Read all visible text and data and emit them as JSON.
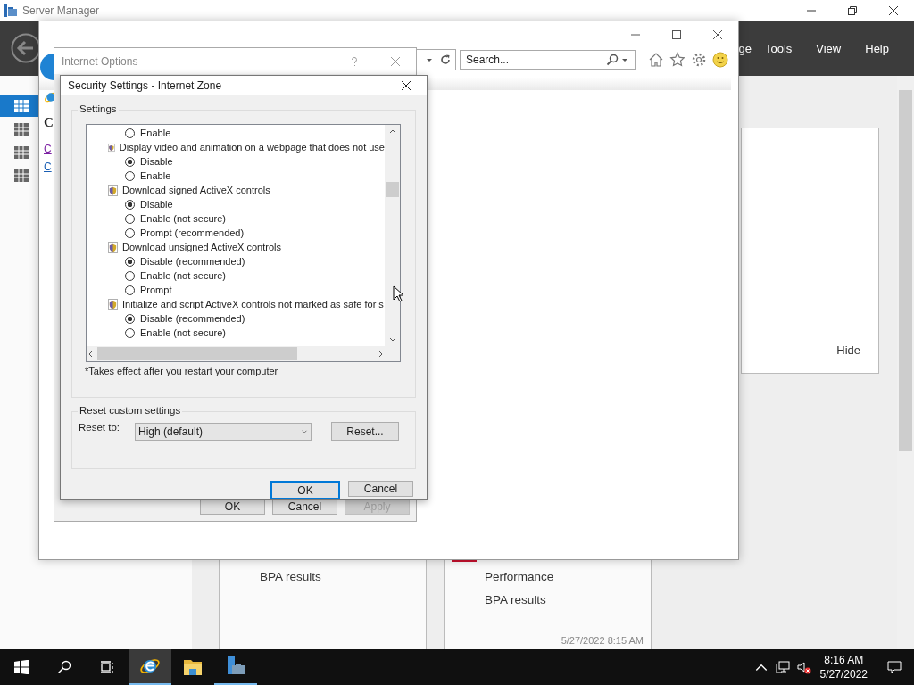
{
  "server_manager": {
    "title": "Server Manager",
    "menu": [
      "ge",
      "Tools",
      "View",
      "Help"
    ],
    "sidebar": [
      {
        "selected": true
      },
      {
        "selected": false
      },
      {
        "selected": false
      },
      {
        "selected": false
      }
    ],
    "hide_link": "Hide",
    "tiles": [
      {
        "alert": false,
        "lines": [
          "BPA results"
        ]
      },
      {
        "alert": true,
        "lines": [
          "Performance",
          "BPA results"
        ],
        "timestamp": "5/27/2022 8:15 AM"
      }
    ]
  },
  "browser": {
    "search": {
      "placeholder": "Search..."
    },
    "page": {
      "heading": "C",
      "links": [
        {
          "label": "C",
          "visited": true
        },
        {
          "label": "C",
          "visited": false
        }
      ]
    }
  },
  "internet_options": {
    "title": "Internet Options",
    "buttons": [
      {
        "label": "OK",
        "disabled": false
      },
      {
        "label": "Cancel",
        "disabled": false
      },
      {
        "label": "Apply",
        "disabled": true
      }
    ]
  },
  "security_settings": {
    "title": "Security Settings - Internet Zone",
    "settings_label": "Settings",
    "tree": [
      {
        "kind": "option",
        "label": "Enable",
        "selected": false
      },
      {
        "kind": "heading",
        "label": "Display video and animation on a webpage that does not use",
        "children": [
          {
            "label": "Disable",
            "selected": true
          },
          {
            "label": "Enable",
            "selected": false
          }
        ]
      },
      {
        "kind": "heading",
        "label": "Download signed ActiveX controls",
        "children": [
          {
            "label": "Disable",
            "selected": true
          },
          {
            "label": "Enable (not secure)",
            "selected": false
          },
          {
            "label": "Prompt (recommended)",
            "selected": false
          }
        ]
      },
      {
        "kind": "heading",
        "label": "Download unsigned ActiveX controls",
        "children": [
          {
            "label": "Disable (recommended)",
            "selected": true
          },
          {
            "label": "Enable (not secure)",
            "selected": false
          },
          {
            "label": "Prompt",
            "selected": false
          }
        ]
      },
      {
        "kind": "heading",
        "label": "Initialize and script ActiveX controls not marked as safe for s",
        "children": [
          {
            "label": "Disable (recommended)",
            "selected": true
          },
          {
            "label": "Enable (not secure)",
            "selected": false
          }
        ]
      }
    ],
    "note": "*Takes effect after you restart your computer",
    "reset_group": {
      "label": "Reset custom settings",
      "reset_to_label": "Reset to:",
      "value": "High (default)",
      "reset_button": "Reset..."
    },
    "buttons": [
      {
        "label": "OK",
        "default": true
      },
      {
        "label": "Cancel",
        "default": false
      }
    ]
  },
  "taskbar": {
    "apps": [
      {
        "kind": "start",
        "selected": false,
        "running": false
      },
      {
        "kind": "search",
        "selected": false,
        "running": false
      },
      {
        "kind": "task_view",
        "selected": false,
        "running": false
      },
      {
        "kind": "browser",
        "selected": true,
        "running": true
      },
      {
        "kind": "folder",
        "selected": false,
        "running": false
      },
      {
        "kind": "server_manager",
        "selected": false,
        "running": true
      }
    ],
    "volume_muted": true,
    "clock": {
      "time": "8:16 AM",
      "date": "5/27/2022"
    }
  }
}
